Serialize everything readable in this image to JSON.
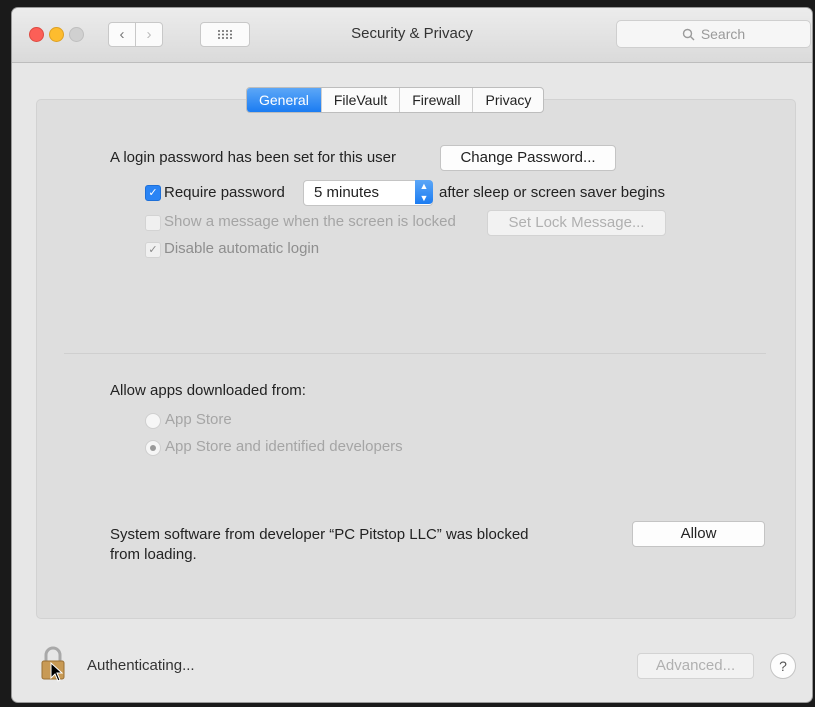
{
  "window": {
    "title": "Security & Privacy",
    "search_placeholder": "Search"
  },
  "tabs": [
    {
      "label": "General",
      "active": true
    },
    {
      "label": "FileVault",
      "active": false
    },
    {
      "label": "Firewall",
      "active": false
    },
    {
      "label": "Privacy",
      "active": false
    }
  ],
  "general": {
    "login_text": "A login password has been set for this user",
    "change_password_label": "Change Password...",
    "require_password": {
      "label": "Require password",
      "checked": true
    },
    "delay_value": "5 minutes",
    "after_sleep_text": "after sleep or screen saver begins",
    "show_message": {
      "label": "Show a message when the screen is locked",
      "checked": false
    },
    "set_lock_message_label": "Set Lock Message...",
    "disable_autologin": {
      "label": "Disable automatic login",
      "checked": true
    }
  },
  "allow_apps": {
    "heading": "Allow apps downloaded from:",
    "options": [
      {
        "label": "App Store",
        "selected": false
      },
      {
        "label": "App Store and identified developers",
        "selected": true
      }
    ]
  },
  "blocked": {
    "line1": "System software from developer “PC Pitstop LLC” was blocked",
    "line2": "from loading.",
    "allow_label": "Allow"
  },
  "footer": {
    "status": "Authenticating...",
    "advanced_label": "Advanced...",
    "help_label": "?"
  },
  "colors": {
    "accent": "#1b7cf2"
  },
  "icons": [
    "lock-icon",
    "search-icon",
    "grid-icon",
    "cursor-arrow-icon"
  ]
}
